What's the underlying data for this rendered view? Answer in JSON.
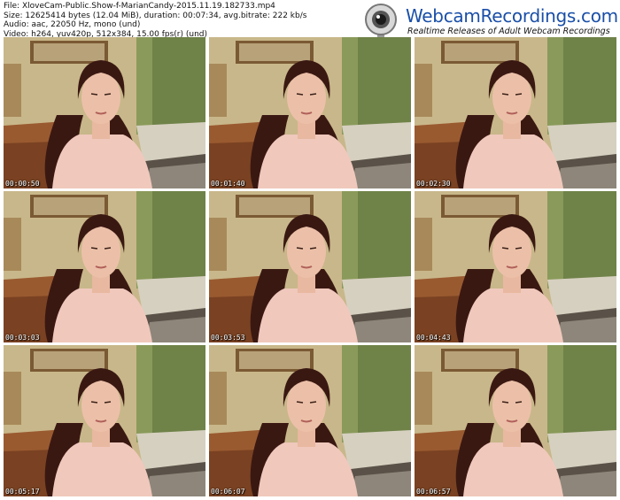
{
  "meta": {
    "file": "File: XloveCam-Public.Show-f-MarianCandy-2015.11.19.182733.mp4",
    "size": "Size: 12625414 bytes (12.04 MiB), duration: 00:07:34, avg.bitrate: 222 kb/s",
    "audio": "Audio: aac, 22050 Hz, mono (und)",
    "video": "Video: h264, yuv420p, 512x384, 15.00 fps(r) (und)"
  },
  "logo": {
    "brand": "WebcamRecordings.com",
    "tagline": "Realtime Releases of Adult Webcam Recordings",
    "icon": "webcam-icon"
  },
  "thumbnails": [
    {
      "timestamp": "00:00:50"
    },
    {
      "timestamp": "00:01:40"
    },
    {
      "timestamp": "00:02:30"
    },
    {
      "timestamp": "00:03:03"
    },
    {
      "timestamp": "00:03:53"
    },
    {
      "timestamp": "00:04:43"
    },
    {
      "timestamp": "00:05:17"
    },
    {
      "timestamp": "00:06:07"
    },
    {
      "timestamp": "00:06:57"
    }
  ]
}
